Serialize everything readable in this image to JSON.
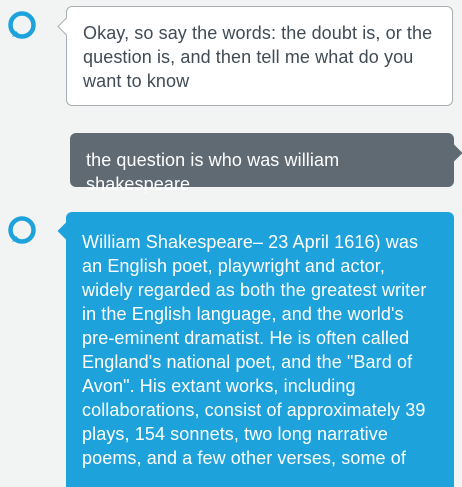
{
  "theme": {
    "alexa_accent": "#1da2dc",
    "user_bubble": "#5f6a72",
    "page_background": "#f2f3f3"
  },
  "conversation": {
    "messages": [
      {
        "sender": "alexa",
        "style": "outlined",
        "icon": "alexa-ring-icon",
        "text": "Okay, so say the words: the doubt is, or the question is, and then tell me what do you want to know"
      },
      {
        "sender": "user",
        "style": "filled-gray",
        "text": "the question is who was william shakespeare"
      },
      {
        "sender": "alexa",
        "style": "filled-blue",
        "icon": "alexa-ring-icon",
        "text": "William Shakespeare– 23 April 1616) was an English poet, playwright and actor, widely regarded as both the greatest writer in the English language, and the world's pre-eminent dramatist. He is often called England's national poet, and the \"Bard of Avon\". His extant works, including collaborations, consist of approximately 39 plays, 154 sonnets, two long narrative poems, and a few other verses, some of"
      }
    ]
  }
}
